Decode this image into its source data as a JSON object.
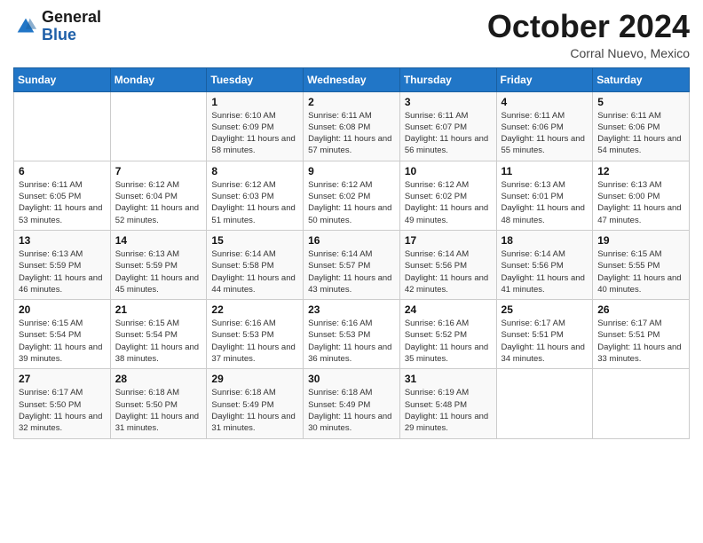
{
  "header": {
    "logo_general": "General",
    "logo_blue": "Blue",
    "month_title": "October 2024",
    "location": "Corral Nuevo, Mexico"
  },
  "days_of_week": [
    "Sunday",
    "Monday",
    "Tuesday",
    "Wednesday",
    "Thursday",
    "Friday",
    "Saturday"
  ],
  "weeks": [
    [
      {
        "day": "",
        "sunrise": "",
        "sunset": "",
        "daylight": ""
      },
      {
        "day": "",
        "sunrise": "",
        "sunset": "",
        "daylight": ""
      },
      {
        "day": "1",
        "sunrise": "Sunrise: 6:10 AM",
        "sunset": "Sunset: 6:09 PM",
        "daylight": "Daylight: 11 hours and 58 minutes."
      },
      {
        "day": "2",
        "sunrise": "Sunrise: 6:11 AM",
        "sunset": "Sunset: 6:08 PM",
        "daylight": "Daylight: 11 hours and 57 minutes."
      },
      {
        "day": "3",
        "sunrise": "Sunrise: 6:11 AM",
        "sunset": "Sunset: 6:07 PM",
        "daylight": "Daylight: 11 hours and 56 minutes."
      },
      {
        "day": "4",
        "sunrise": "Sunrise: 6:11 AM",
        "sunset": "Sunset: 6:06 PM",
        "daylight": "Daylight: 11 hours and 55 minutes."
      },
      {
        "day": "5",
        "sunrise": "Sunrise: 6:11 AM",
        "sunset": "Sunset: 6:06 PM",
        "daylight": "Daylight: 11 hours and 54 minutes."
      }
    ],
    [
      {
        "day": "6",
        "sunrise": "Sunrise: 6:11 AM",
        "sunset": "Sunset: 6:05 PM",
        "daylight": "Daylight: 11 hours and 53 minutes."
      },
      {
        "day": "7",
        "sunrise": "Sunrise: 6:12 AM",
        "sunset": "Sunset: 6:04 PM",
        "daylight": "Daylight: 11 hours and 52 minutes."
      },
      {
        "day": "8",
        "sunrise": "Sunrise: 6:12 AM",
        "sunset": "Sunset: 6:03 PM",
        "daylight": "Daylight: 11 hours and 51 minutes."
      },
      {
        "day": "9",
        "sunrise": "Sunrise: 6:12 AM",
        "sunset": "Sunset: 6:02 PM",
        "daylight": "Daylight: 11 hours and 50 minutes."
      },
      {
        "day": "10",
        "sunrise": "Sunrise: 6:12 AM",
        "sunset": "Sunset: 6:02 PM",
        "daylight": "Daylight: 11 hours and 49 minutes."
      },
      {
        "day": "11",
        "sunrise": "Sunrise: 6:13 AM",
        "sunset": "Sunset: 6:01 PM",
        "daylight": "Daylight: 11 hours and 48 minutes."
      },
      {
        "day": "12",
        "sunrise": "Sunrise: 6:13 AM",
        "sunset": "Sunset: 6:00 PM",
        "daylight": "Daylight: 11 hours and 47 minutes."
      }
    ],
    [
      {
        "day": "13",
        "sunrise": "Sunrise: 6:13 AM",
        "sunset": "Sunset: 5:59 PM",
        "daylight": "Daylight: 11 hours and 46 minutes."
      },
      {
        "day": "14",
        "sunrise": "Sunrise: 6:13 AM",
        "sunset": "Sunset: 5:59 PM",
        "daylight": "Daylight: 11 hours and 45 minutes."
      },
      {
        "day": "15",
        "sunrise": "Sunrise: 6:14 AM",
        "sunset": "Sunset: 5:58 PM",
        "daylight": "Daylight: 11 hours and 44 minutes."
      },
      {
        "day": "16",
        "sunrise": "Sunrise: 6:14 AM",
        "sunset": "Sunset: 5:57 PM",
        "daylight": "Daylight: 11 hours and 43 minutes."
      },
      {
        "day": "17",
        "sunrise": "Sunrise: 6:14 AM",
        "sunset": "Sunset: 5:56 PM",
        "daylight": "Daylight: 11 hours and 42 minutes."
      },
      {
        "day": "18",
        "sunrise": "Sunrise: 6:14 AM",
        "sunset": "Sunset: 5:56 PM",
        "daylight": "Daylight: 11 hours and 41 minutes."
      },
      {
        "day": "19",
        "sunrise": "Sunrise: 6:15 AM",
        "sunset": "Sunset: 5:55 PM",
        "daylight": "Daylight: 11 hours and 40 minutes."
      }
    ],
    [
      {
        "day": "20",
        "sunrise": "Sunrise: 6:15 AM",
        "sunset": "Sunset: 5:54 PM",
        "daylight": "Daylight: 11 hours and 39 minutes."
      },
      {
        "day": "21",
        "sunrise": "Sunrise: 6:15 AM",
        "sunset": "Sunset: 5:54 PM",
        "daylight": "Daylight: 11 hours and 38 minutes."
      },
      {
        "day": "22",
        "sunrise": "Sunrise: 6:16 AM",
        "sunset": "Sunset: 5:53 PM",
        "daylight": "Daylight: 11 hours and 37 minutes."
      },
      {
        "day": "23",
        "sunrise": "Sunrise: 6:16 AM",
        "sunset": "Sunset: 5:53 PM",
        "daylight": "Daylight: 11 hours and 36 minutes."
      },
      {
        "day": "24",
        "sunrise": "Sunrise: 6:16 AM",
        "sunset": "Sunset: 5:52 PM",
        "daylight": "Daylight: 11 hours and 35 minutes."
      },
      {
        "day": "25",
        "sunrise": "Sunrise: 6:17 AM",
        "sunset": "Sunset: 5:51 PM",
        "daylight": "Daylight: 11 hours and 34 minutes."
      },
      {
        "day": "26",
        "sunrise": "Sunrise: 6:17 AM",
        "sunset": "Sunset: 5:51 PM",
        "daylight": "Daylight: 11 hours and 33 minutes."
      }
    ],
    [
      {
        "day": "27",
        "sunrise": "Sunrise: 6:17 AM",
        "sunset": "Sunset: 5:50 PM",
        "daylight": "Daylight: 11 hours and 32 minutes."
      },
      {
        "day": "28",
        "sunrise": "Sunrise: 6:18 AM",
        "sunset": "Sunset: 5:50 PM",
        "daylight": "Daylight: 11 hours and 31 minutes."
      },
      {
        "day": "29",
        "sunrise": "Sunrise: 6:18 AM",
        "sunset": "Sunset: 5:49 PM",
        "daylight": "Daylight: 11 hours and 31 minutes."
      },
      {
        "day": "30",
        "sunrise": "Sunrise: 6:18 AM",
        "sunset": "Sunset: 5:49 PM",
        "daylight": "Daylight: 11 hours and 30 minutes."
      },
      {
        "day": "31",
        "sunrise": "Sunrise: 6:19 AM",
        "sunset": "Sunset: 5:48 PM",
        "daylight": "Daylight: 11 hours and 29 minutes."
      },
      {
        "day": "",
        "sunrise": "",
        "sunset": "",
        "daylight": ""
      },
      {
        "day": "",
        "sunrise": "",
        "sunset": "",
        "daylight": ""
      }
    ]
  ]
}
